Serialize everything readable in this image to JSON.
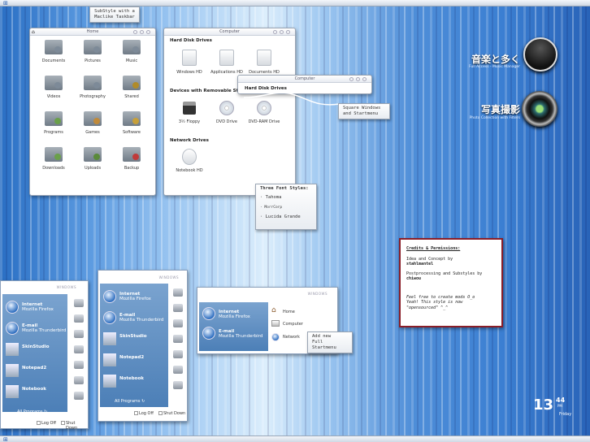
{
  "home_window": {
    "title": "Home",
    "items": [
      "Documents",
      "Pictures",
      "Music",
      "Videos",
      "Photography",
      "Shared",
      "Programs",
      "Games",
      "Software",
      "Downloads",
      "Uploads",
      "Backup"
    ]
  },
  "computer_window": {
    "title": "Computer",
    "hard_disk_section": "Hard Disk Drives",
    "hard_disks": [
      "Windows HD",
      "Applications HD",
      "Documents HD"
    ],
    "removable_section": "Devices with Removable Storage",
    "removable": [
      "3½ Floppy",
      "DVD Drive",
      "DVD-RAM Drive"
    ],
    "network_section": "Network Drives",
    "network": [
      "Notebook HD"
    ]
  },
  "computer_small": {
    "title": "Computer",
    "section": "Hard Disk Drives"
  },
  "labels": {
    "substyle": "SubStyle with a\nMaclike Taskbar",
    "square": "Square Windows\nand Startmenu",
    "add_new": "Add new\nFull Startmenu"
  },
  "fonts_note": {
    "title": "Three Font Styles:",
    "items": [
      "Tahoma",
      "MorrCorp",
      "Lucida Grande"
    ]
  },
  "credits": {
    "title": "Credits & Permissions:",
    "line1": "Idea and Concept by",
    "name1": "stahlmantel",
    "line2": "Postprocessing and Substyles by",
    "name2": "chiwou",
    "note1": "Feel free to create mods O_o",
    "note2": "Yeah! This style is now",
    "note3": "\"opensourced\" ^_^"
  },
  "widgets": [
    {
      "title": "音楽と多く",
      "subtitle": "Full Access - Music Manager"
    },
    {
      "title": "写真撮影",
      "subtitle": "Photo Collection with Filters"
    }
  ],
  "clock": {
    "hours": "13",
    "minutes": "44",
    "ampm": "PM",
    "day": "Friday"
  },
  "startmenu": {
    "brand": "WINDOWS",
    "entries": [
      {
        "t": "Internet",
        "s": "Mozilla Firefox"
      },
      {
        "t": "E-mail",
        "s": "Mozilla Thunderbird"
      },
      {
        "t": "SkinStudio",
        "s": ""
      },
      {
        "t": "Notepad2",
        "s": ""
      },
      {
        "t": "Notebook",
        "s": ""
      }
    ],
    "all_programs": "All Programs",
    "log_off": "Log Off",
    "shut_down": "Shut Down"
  },
  "full_startmenu": {
    "brand": "WINDOWS",
    "entries": [
      {
        "t": "Internet",
        "s": "Mozilla Firefox"
      },
      {
        "t": "E-mail",
        "s": "Mozilla Thunderbird"
      }
    ],
    "links": [
      "Home",
      "Computer",
      "Network"
    ]
  }
}
